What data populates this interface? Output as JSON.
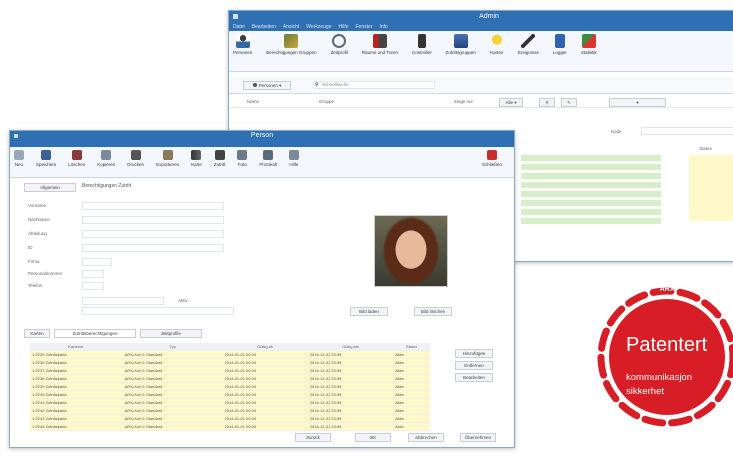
{
  "back_window": {
    "title": "Admin",
    "menu": [
      "Datei",
      "Bearbeiten",
      "Ansicht",
      "Werkzeuge",
      "Hilfe",
      "Fenster",
      "Info"
    ],
    "toolbar": [
      "Personen",
      "Berechtigungen Gruppen",
      "Zeitprofil",
      "Räume und Türen",
      "Controller",
      "Zutrittsgruppen",
      "Karten",
      "Ereignisse",
      "Logger",
      "Statistik"
    ],
    "filter_label": "Personen",
    "search_placeholder": "Schnellsuche",
    "col_name": "Name",
    "col_group": "Gruppe",
    "show_label": "Zeige nur",
    "pagesize": "Alle",
    "code_label": "Kode",
    "status_col": "Status"
  },
  "front_window": {
    "title": "Person",
    "toolbar": [
      "Neu",
      "Speichern",
      "Löschen",
      "Kopieren",
      "Drucken",
      "Exportieren",
      "Karte",
      "Zutritt",
      "Foto",
      "Protokoll",
      "Hilfe"
    ],
    "close_label": "Schließen",
    "tabs": [
      "Allgemein",
      "Berechtigungen Zutritt"
    ],
    "form_labels": [
      "Vorname",
      "Nachname",
      "Abteilung",
      "ID",
      "Firma",
      "Personalnummer",
      "Telefon"
    ],
    "checkbox_label": "Aktiv",
    "photo_buttons": [
      "Bild laden",
      "Bild löschen"
    ],
    "grid_tabs": [
      "Karten",
      "Zutrittsberechtigungen",
      "Zeitprofile"
    ],
    "grid_headers": [
      "Kartennr.",
      "Typ",
      "Gültig ab",
      "Gültig bis",
      "Status"
    ],
    "grid_rows": [
      [
        "1-0235 Zutrittskarte",
        "ARX-Kort 1 Standard",
        "2014-01-01 00:00",
        "2016-12-31 23:59",
        "Aktiv"
      ],
      [
        "1-0236 Zutrittskarte",
        "ARX-Kort 1 Standard",
        "2014-01-01 00:00",
        "2016-12-31 23:59",
        "Aktiv"
      ],
      [
        "1-0237 Zutrittskarte",
        "ARX-Kort 1 Standard",
        "2014-01-01 00:00",
        "2016-12-31 23:59",
        "Aktiv"
      ],
      [
        "1-0238 Zutrittskarte",
        "ARX-Kort 1 Standard",
        "2014-01-01 00:00",
        "2016-12-31 23:59",
        "Aktiv"
      ],
      [
        "1-0239 Zutrittskarte",
        "ARX-Kort 1 Standard",
        "2014-01-01 00:00",
        "2016-12-31 23:59",
        "Aktiv"
      ],
      [
        "1-0240 Zutrittskarte",
        "ARX-Kort 1 Standard",
        "2014-01-01 00:00",
        "2016-12-31 23:59",
        "Aktiv"
      ],
      [
        "1-0241 Zutrittskarte",
        "ARX-Kort 1 Standard",
        "2014-01-01 00:00",
        "2016-12-31 23:59",
        "Aktiv"
      ],
      [
        "1-0242 Zutrittskarte",
        "ARX-Kort 1 Standard",
        "2014-01-01 00:00",
        "2016-12-31 23:59",
        "Aktiv"
      ],
      [
        "1-0243 Zutrittskarte",
        "ARX-Kort 1 Standard",
        "2014-01-01 00:00",
        "2016-12-31 23:59",
        "Aktiv"
      ],
      [
        "1-0244 Zutrittskarte",
        "ARX-Kort 1 Standard",
        "2014-01-01 00:00",
        "2016-12-31 23:59",
        "Aktiv"
      ]
    ],
    "side_buttons": [
      "Hinzufügen",
      "Entfernen",
      "Bearbeiten"
    ],
    "footer_buttons": [
      "Zurück",
      "OK",
      "Abbrechen",
      "Übernehmen"
    ]
  },
  "badge": {
    "brand": "ARX",
    "line1": "Patentert",
    "line2": "kommunikasjon",
    "line3": "sikkerhet",
    "color": "#d71e26"
  },
  "colors": {
    "window_title": "#2f6fb3",
    "green_row": "#d7efc9",
    "yellow_row": "#fff8c9"
  }
}
